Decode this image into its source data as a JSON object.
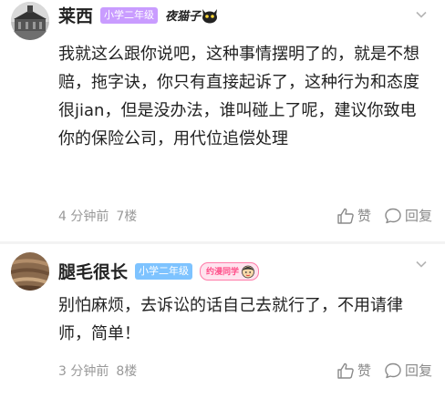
{
  "comments": [
    {
      "username": "莱西",
      "level": "小学二年级",
      "title_tag": "夜猫子",
      "text": "我就这么跟你说吧，这种事情摆明了的，就是不想赔，拖字诀，你只有直接起诉了，这种行为和态度很jian，但是没办法，谁叫碰上了呢，建议你致电你的保险公司，用代位追偿处理",
      "time": "4 分钟前",
      "floor": "7楼",
      "like_label": "赞",
      "reply_label": "回复"
    },
    {
      "username": "腿毛很长",
      "level": "小学二年级",
      "title_tag": "约漫同学",
      "text": "别怕麻烦，去诉讼的话自己去就行了，不用请律师，简单！",
      "time": "3 分钟前",
      "floor": "8楼",
      "like_label": "赞",
      "reply_label": "回复"
    }
  ],
  "colors": {
    "level_badge_1": "#c99cff",
    "level_badge_2": "#7ec3ff",
    "meta_text": "#999999",
    "separator": "#f3f3f3"
  }
}
